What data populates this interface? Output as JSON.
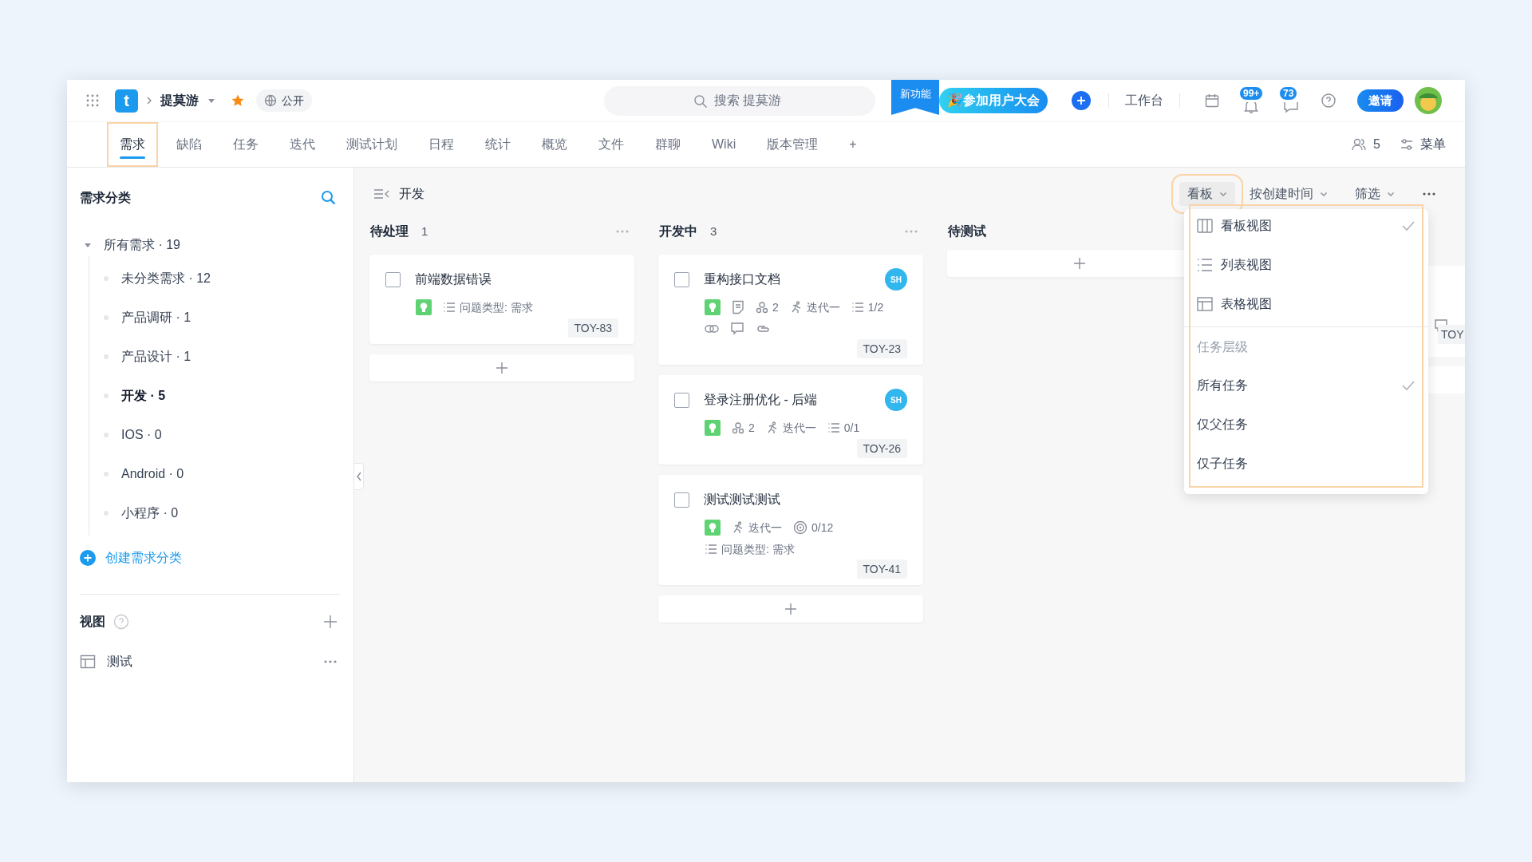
{
  "topbar": {
    "logo": "t",
    "project": "提莫游",
    "starred": true,
    "visibility": "公开",
    "search_placeholder": "搜索 提莫游",
    "new_feature_ribbon": "新功能",
    "event_button": "🎉参加用户大会",
    "workbench": "工作台",
    "notification_badge": "99+",
    "message_badge": "73",
    "invite": "邀请"
  },
  "tabs": [
    {
      "label": "需求",
      "selected": true,
      "highlighted": true
    },
    {
      "label": "缺陷",
      "selected": false,
      "highlighted": false
    },
    {
      "label": "任务",
      "selected": false,
      "highlighted": false
    },
    {
      "label": "迭代",
      "selected": false,
      "highlighted": false
    },
    {
      "label": "测试计划",
      "selected": false,
      "highlighted": false
    },
    {
      "label": "日程",
      "selected": false,
      "highlighted": false
    },
    {
      "label": "统计",
      "selected": false,
      "highlighted": false
    },
    {
      "label": "概览",
      "selected": false,
      "highlighted": false
    },
    {
      "label": "文件",
      "selected": false,
      "highlighted": false
    },
    {
      "label": "群聊",
      "selected": false,
      "highlighted": false
    },
    {
      "label": "Wiki",
      "selected": false,
      "highlighted": false
    },
    {
      "label": "版本管理",
      "selected": false,
      "highlighted": false
    },
    {
      "label": "+",
      "selected": false,
      "highlighted": false
    }
  ],
  "tab_actions": {
    "members": "5",
    "menu": "菜单"
  },
  "sidebar": {
    "title": "需求分类",
    "tree": {
      "label": "所有需求 · 19",
      "expanded": true,
      "children": [
        {
          "label": "未分类需求 · 12",
          "selected": false
        },
        {
          "label": "产品调研 · 1",
          "selected": false
        },
        {
          "label": "产品设计 · 1",
          "selected": false
        },
        {
          "label": "开发 · 5",
          "selected": true
        },
        {
          "label": "IOS · 0",
          "selected": false
        },
        {
          "label": "Android · 0",
          "selected": false
        },
        {
          "label": "小程序 · 0",
          "selected": false
        }
      ]
    },
    "create_link": "创建需求分类",
    "views_title": "视图",
    "views": [
      {
        "label": "测试"
      }
    ]
  },
  "board": {
    "title": "开发",
    "toolbar": [
      {
        "label": "看板",
        "kind": "view",
        "highlighted": true
      },
      {
        "label": "按创建时间",
        "kind": "sort",
        "highlighted": false
      },
      {
        "label": "筛选",
        "kind": "filter",
        "highlighted": false
      }
    ],
    "columns": [
      {
        "title": "待处理",
        "count": "1",
        "cards": [
          {
            "title": "前端数据错误",
            "checked": false,
            "rows": [
              [
                {
                  "kind": "type"
                },
                {
                  "kind": "issue-type",
                  "text": "问题类型: 需求"
                }
              ]
            ],
            "id": "TOY-83"
          }
        ]
      },
      {
        "title": "开发中",
        "count": "3",
        "cards": [
          {
            "title": "重构接口文档",
            "checked": false,
            "avatar": "SH",
            "rows": [
              [
                {
                  "kind": "type"
                },
                {
                  "kind": "doc"
                },
                {
                  "kind": "people",
                  "text": "2"
                },
                {
                  "kind": "iteration",
                  "text": "迭代一"
                },
                {
                  "kind": "subtasks",
                  "text": "1/2"
                }
              ],
              [
                {
                  "kind": "link"
                },
                {
                  "kind": "comment"
                },
                {
                  "kind": "attach"
                }
              ]
            ],
            "id": "TOY-23"
          },
          {
            "title": "登录注册优化 - 后端",
            "checked": false,
            "avatar": "SH",
            "rows": [
              [
                {
                  "kind": "type"
                },
                {
                  "kind": "people",
                  "text": "2"
                },
                {
                  "kind": "iteration",
                  "text": "迭代一"
                },
                {
                  "kind": "subtasks",
                  "text": "0/1"
                }
              ]
            ],
            "id": "TOY-26"
          },
          {
            "title": "测试测试测试",
            "checked": false,
            "rows": [
              [
                {
                  "kind": "type"
                },
                {
                  "kind": "iteration",
                  "text": "迭代一"
                },
                {
                  "kind": "target",
                  "text": "0/12"
                }
              ],
              [
                {
                  "kind": "issue-type",
                  "text": "问题类型: 需求"
                }
              ]
            ],
            "id": "TOY-41"
          }
        ]
      },
      {
        "title": "待测试"
      }
    ],
    "hidden_column_card": {
      "id": "TOY"
    }
  },
  "dropdown": {
    "highlighted": true,
    "sections": [
      {
        "items": [
          {
            "kind": "board",
            "label": "看板视图",
            "checked": true
          },
          {
            "kind": "list",
            "label": "列表视图",
            "checked": false
          },
          {
            "kind": "table",
            "label": "表格视图",
            "checked": false
          }
        ]
      },
      {
        "header": "任务层级",
        "items": [
          {
            "kind": "plain",
            "label": "所有任务",
            "checked": true
          },
          {
            "kind": "plain",
            "label": "仅父任务",
            "checked": false
          },
          {
            "kind": "plain",
            "label": "仅子任务",
            "checked": false
          }
        ]
      }
    ]
  }
}
